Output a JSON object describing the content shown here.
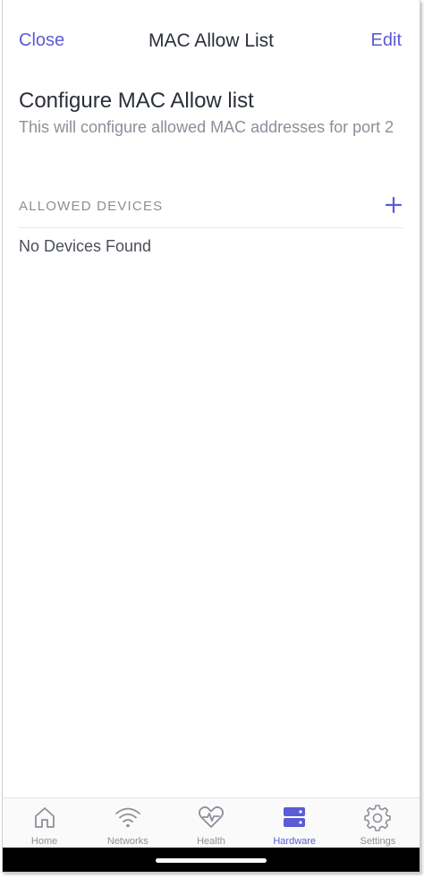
{
  "navbar": {
    "close_label": "Close",
    "title": "MAC Allow List",
    "edit_label": "Edit"
  },
  "header": {
    "title": "Configure MAC Allow list",
    "description": "This will configure allowed MAC addresses for port 2"
  },
  "section": {
    "title": "ALLOWED DEVICES",
    "add_icon": "plus-icon",
    "empty_text": "No Devices Found"
  },
  "tabbar": {
    "tabs": [
      {
        "label": "Home",
        "icon": "home-icon",
        "active": false
      },
      {
        "label": "Networks",
        "icon": "wifi-icon",
        "active": false
      },
      {
        "label": "Health",
        "icon": "heart-pulse-icon",
        "active": false
      },
      {
        "label": "Hardware",
        "icon": "server-icon",
        "active": true
      },
      {
        "label": "Settings",
        "icon": "gear-icon",
        "active": false
      }
    ]
  },
  "colors": {
    "accent": "#5b5bd6",
    "title_text": "#2a2f3a",
    "muted_text": "#8a8f99",
    "tab_inactive": "#8e9099"
  }
}
